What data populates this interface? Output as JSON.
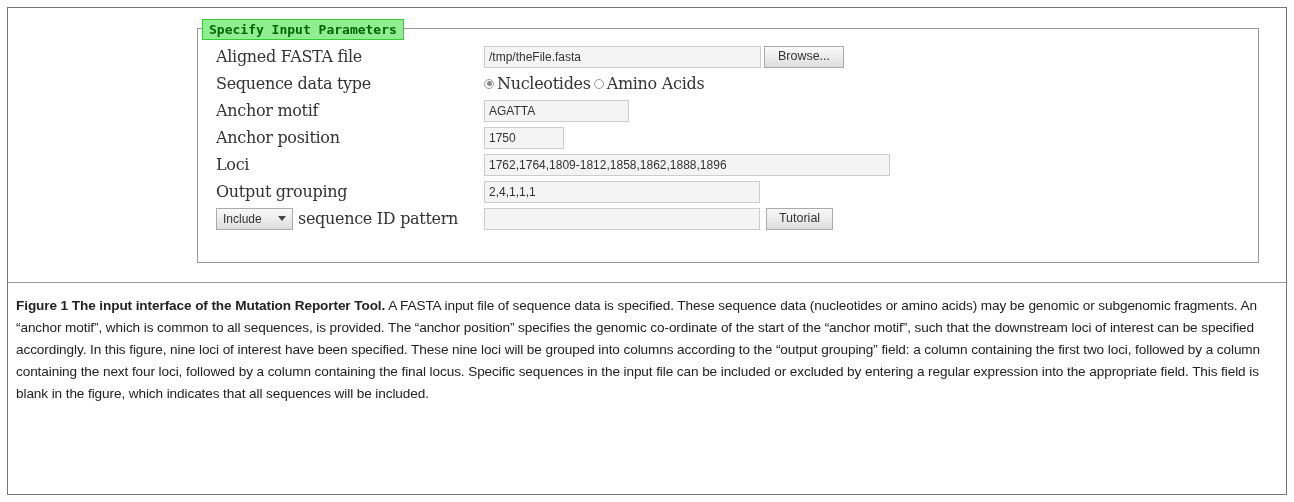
{
  "form": {
    "legend": "Specify Input Parameters",
    "rows": [
      {
        "kind": "file",
        "label": "Aligned FASTA file",
        "value": "/tmp/theFile.fasta",
        "button": "Browse..."
      },
      {
        "kind": "radio",
        "label": "Sequence data type",
        "options": [
          {
            "label": "Nucleotides",
            "selected": true
          },
          {
            "label": "Amino Acids",
            "selected": false
          }
        ]
      },
      {
        "kind": "text",
        "label": "Anchor motif",
        "value": "AGATTA"
      },
      {
        "kind": "text",
        "label": "Anchor position",
        "value": "1750"
      },
      {
        "kind": "text",
        "label": "Loci",
        "value": "1762,1764,1809-1812,1858,1862,1888,1896"
      },
      {
        "kind": "text",
        "label": "Output grouping",
        "value": "2,4,1,1,1"
      },
      {
        "kind": "select_text",
        "select": "Include",
        "label": "sequence ID pattern",
        "value": "",
        "button": "Tutorial"
      }
    ]
  },
  "caption": "**Figure 1 The input interface of the Mutation Reporter Tool.** A FASTA input file of sequence data is specified. These sequence data (nucleotides or amino acids) may be genomic or subgenomic fragments. An “anchor motif”, which is common to all sequences, is provided. The “anchor position” specifies the genomic co-ordinate of the start of the “anchor motif”, such that the downstream loci of interest can be specified accordingly. In this figure, nine loci of interest have been specified. These nine loci will be grouped into columns according to the “output grouping” field: a column containing the first two loci, followed by a column containing the next four loci, followed by a column containing the final locus. Specific sequences in the input file can be included or excluded by entering a regular expression into the appropriate field. This field is blank in the figure, which indicates that all sequences will be included."
}
